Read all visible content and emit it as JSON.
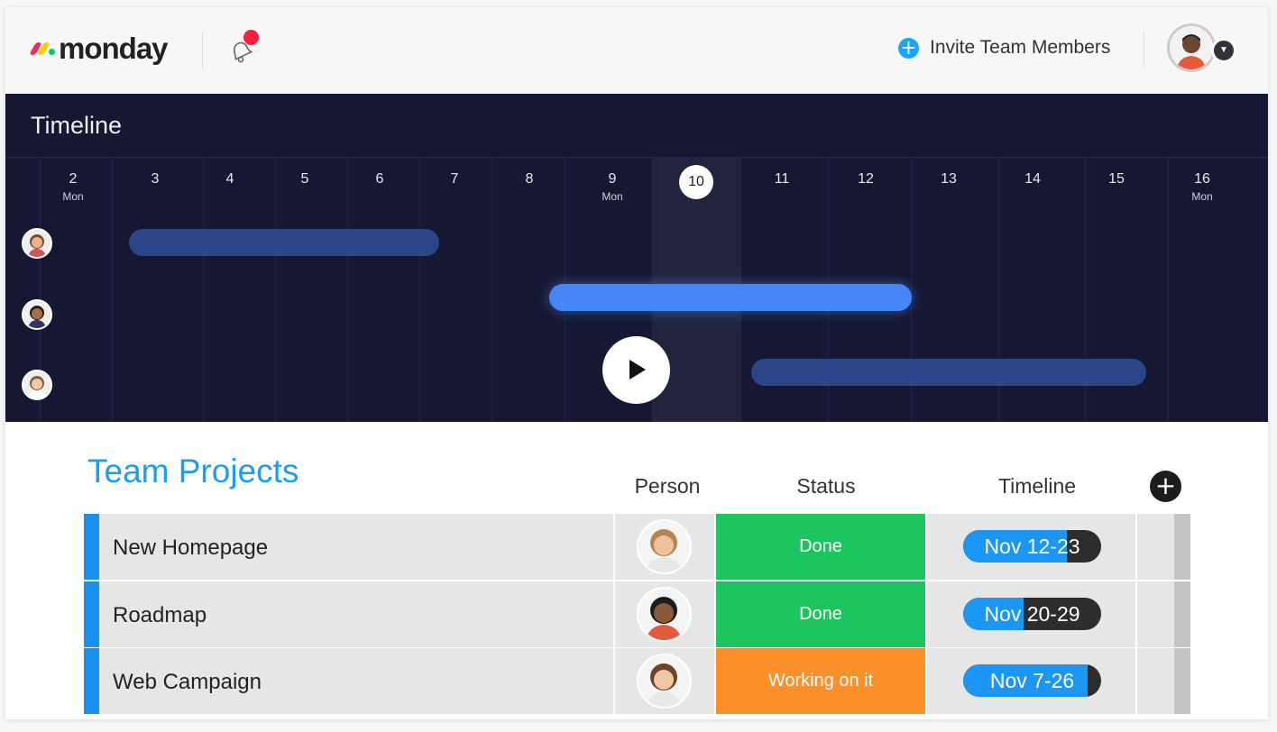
{
  "header": {
    "brand": "monday",
    "bell_icon": "bell-icon",
    "invite_label": "Invite Team Members",
    "invite_icon": "plus-circle-icon",
    "user_avatar": "avatar-user",
    "caret_icon": "chevron-down-icon"
  },
  "timeline": {
    "title": "Timeline",
    "days": [
      {
        "num": "2",
        "weekday": "Mon"
      },
      {
        "num": "3",
        "weekday": ""
      },
      {
        "num": "4",
        "weekday": ""
      },
      {
        "num": "5",
        "weekday": ""
      },
      {
        "num": "6",
        "weekday": ""
      },
      {
        "num": "7",
        "weekday": ""
      },
      {
        "num": "8",
        "weekday": ""
      },
      {
        "num": "9",
        "weekday": "Mon"
      },
      {
        "num": "10",
        "weekday": "",
        "today": true
      },
      {
        "num": "11",
        "weekday": ""
      },
      {
        "num": "12",
        "weekday": ""
      },
      {
        "num": "13",
        "weekday": ""
      },
      {
        "num": "14",
        "weekday": ""
      },
      {
        "num": "15",
        "weekday": ""
      },
      {
        "num": "16",
        "weekday": "Mon"
      }
    ],
    "rows": [
      {
        "person": "woman-1",
        "bar_color": "#2b4589"
      },
      {
        "person": "man-1",
        "bar_color": "#4585f6"
      },
      {
        "person": "woman-2",
        "bar_color": "#2b4589"
      }
    ],
    "play_icon": "play-icon"
  },
  "board": {
    "title": "Team Projects",
    "columns": {
      "person": "Person",
      "status": "Status",
      "timeline": "Timeline"
    },
    "add_column_icon": "plus-icon",
    "rows": [
      {
        "name": "New Homepage",
        "status": "Done",
        "status_color": "#1cc55f",
        "timeline": "Nov 12-23",
        "progress": 0.75
      },
      {
        "name": "Roadmap",
        "status": "Done",
        "status_color": "#1cc55f",
        "timeline": "Nov 20-29",
        "progress": 0.44
      },
      {
        "name": "Web Campaign",
        "status": "Working on it",
        "status_color": "#fb902b",
        "timeline": "Nov 7-26",
        "progress": 0.9
      }
    ]
  },
  "colors": {
    "accent": "#1b9df0",
    "timeline_bg": "#161732",
    "done": "#1cc55f",
    "working": "#fb902b"
  }
}
